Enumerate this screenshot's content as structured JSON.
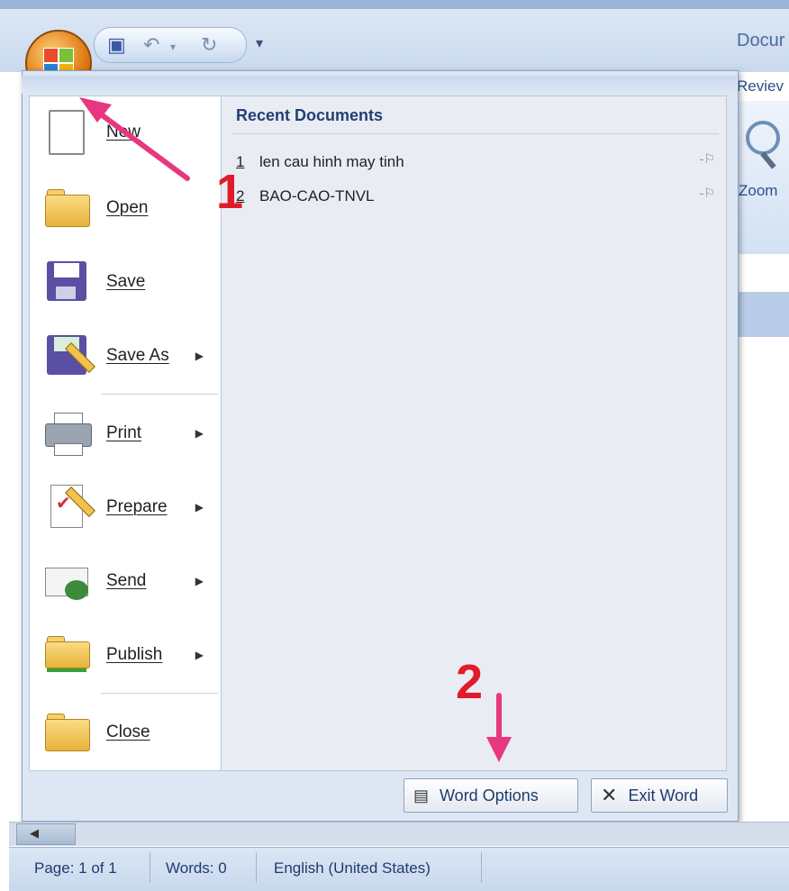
{
  "window": {
    "title": "Docur",
    "ribbon_tab": "Reviev",
    "zoom_label": "Zoom"
  },
  "menu": {
    "items": [
      {
        "label": "New",
        "icon": "new-document-icon",
        "submenu": false
      },
      {
        "label": "Open",
        "icon": "open-folder-icon",
        "submenu": false
      },
      {
        "label": "Save",
        "icon": "save-floppy-icon",
        "submenu": false
      },
      {
        "label": "Save As",
        "icon": "save-as-icon",
        "submenu": true
      },
      {
        "label": "Print",
        "icon": "printer-icon",
        "submenu": true
      },
      {
        "label": "Prepare",
        "icon": "prepare-icon",
        "submenu": true
      },
      {
        "label": "Send",
        "icon": "send-icon",
        "submenu": true
      },
      {
        "label": "Publish",
        "icon": "publish-icon",
        "submenu": true
      },
      {
        "label": "Close",
        "icon": "close-folder-icon",
        "submenu": false
      }
    ],
    "recent_title": "Recent Documents",
    "recent_docs": [
      {
        "num": "1",
        "name": "len cau hinh may tinh"
      },
      {
        "num": "2",
        "name": "BAO-CAO-TNVL"
      }
    ],
    "word_options_label": "Word Options",
    "exit_word_label": "Exit Word"
  },
  "annotations": {
    "step1": "1",
    "step2": "2",
    "arrow_color": "#e8377f",
    "number_color": "#e21b2b"
  },
  "status_bar": {
    "page": "Page: 1 of 1",
    "words": "Words: 0",
    "language": "English (United States)"
  },
  "colors": {
    "menu_bg": "#dde7f3",
    "accent": "#1f3b6e"
  }
}
